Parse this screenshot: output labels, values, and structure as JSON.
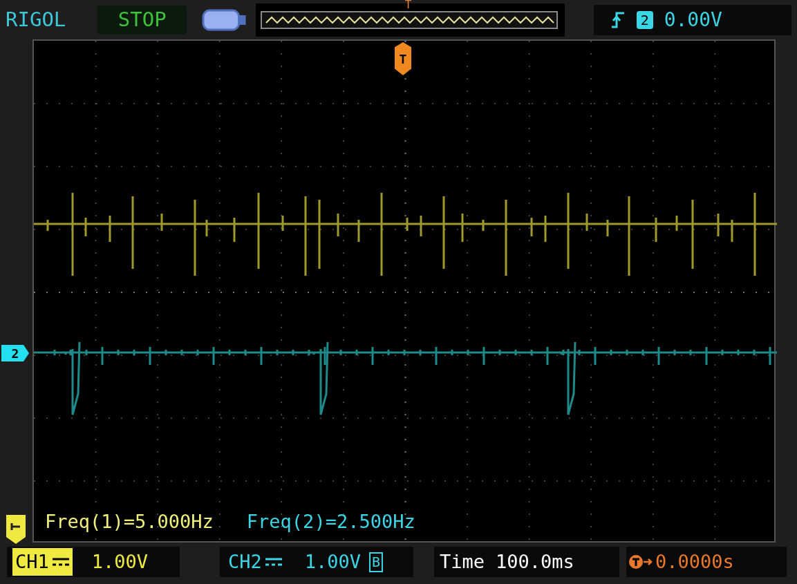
{
  "header": {
    "brand": "RIGOL",
    "run_state": "STOP",
    "memory_trigger_marker": "T",
    "trigger_source": "2",
    "trigger_level": "0.00V"
  },
  "screen": {
    "trigger_marker": "T",
    "channel_markers": [
      {
        "label": "2",
        "color": "#22e0f0"
      }
    ],
    "measurements": [
      {
        "text": "Freq(1)=5.000Hz",
        "color": "#f0f07a"
      },
      {
        "text": "Freq(2)=2.500Hz",
        "color": "#3ad6e6"
      }
    ]
  },
  "footer": {
    "channels": [
      {
        "name": "CH1",
        "scale": "1.00V",
        "selected": true,
        "color": "#f0ea40"
      },
      {
        "name": "CH2",
        "scale": "1.00V",
        "selected": false,
        "color": "#3ad6e6",
        "bandwidth_badge": "B"
      }
    ],
    "time_label": "Time",
    "time_value": "100.0ms",
    "trigger_offset": "0.0000s"
  }
}
